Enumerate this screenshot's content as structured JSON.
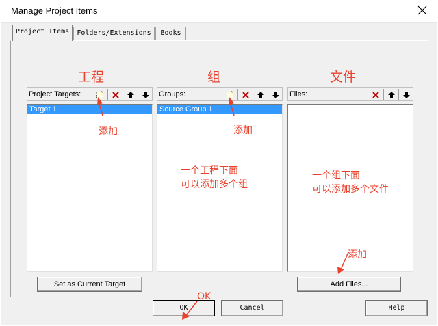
{
  "window": {
    "title": "Manage Project Items",
    "close_glyph": "✕"
  },
  "tabs": [
    {
      "label": "Project Items",
      "active": true
    },
    {
      "label": "Folders/Extensions",
      "active": false
    },
    {
      "label": "Books",
      "active": false
    }
  ],
  "targets": {
    "header_label": "Project Targets:",
    "items": [
      "Target 1"
    ],
    "selected": "Target 1",
    "set_current_label": "Set as Current Target"
  },
  "groups": {
    "header_label": "Groups:",
    "items": [
      "Source Group 1"
    ],
    "selected": "Source Group 1"
  },
  "files": {
    "header_label": "Files:",
    "items": [],
    "add_files_label": "Add Files..."
  },
  "toolbar_icons": [
    "new-icon",
    "delete-icon",
    "move-up-icon",
    "move-down-icon"
  ],
  "footer": {
    "ok_label": "OK",
    "cancel_label": "Cancel",
    "help_label": "Help"
  },
  "annotations": {
    "targets_title": "工程",
    "groups_title": "组",
    "files_title": "文件",
    "add_targets": "添加",
    "add_groups": "添加",
    "add_files": "添加",
    "ok_note": "OK",
    "groups_note_line1": "一个工程下面",
    "groups_note_line2": "可以添加多个组",
    "files_note_line1": "一个组下面",
    "files_note_line2": "可以添加多个文件",
    "color": "#e8412c"
  }
}
